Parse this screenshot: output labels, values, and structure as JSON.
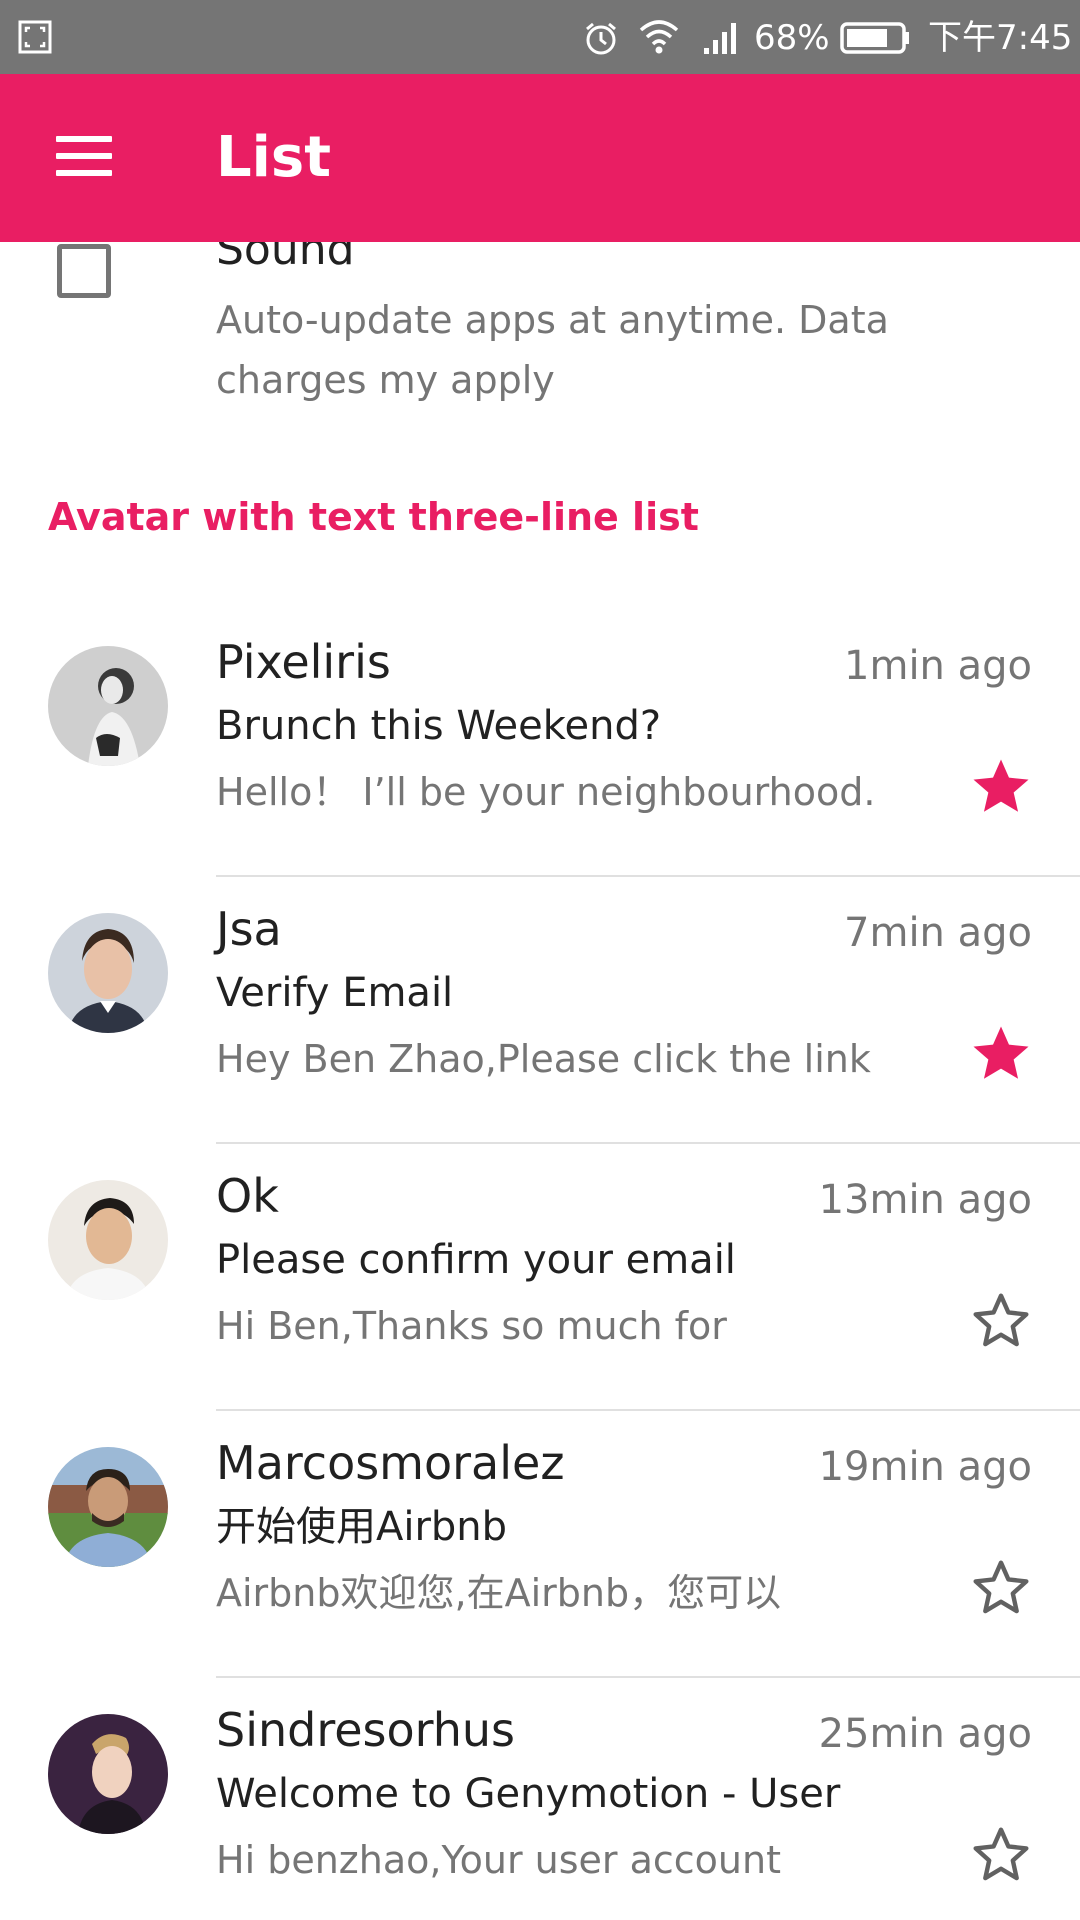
{
  "status_bar": {
    "battery_pct": "68%",
    "clock": "下午7:45",
    "icons": [
      "screenshot-icon",
      "alarm-icon",
      "wifi-icon",
      "signal-icon",
      "battery-icon"
    ]
  },
  "app_bar": {
    "title": "List",
    "menu_icon": "menu-icon"
  },
  "sound_item": {
    "title": "Sound",
    "subtitle": "Auto-update apps at anytime. Data charges my apply",
    "checked": false
  },
  "section": {
    "header": "Avatar with text three-line list"
  },
  "accent_color": "#e91e63",
  "messages": [
    {
      "name": "Pixeliris",
      "time": "1min ago",
      "subject": "Brunch this Weekend?",
      "preview": "Hello！ I’ll be your neighbourhood.",
      "starred": true
    },
    {
      "name": "Jsa",
      "time": "7min ago",
      "subject": "Verify Email",
      "preview": "Hey Ben Zhao,Please click the link",
      "starred": true
    },
    {
      "name": "Ok",
      "time": "13min ago",
      "subject": "Please confirm your email",
      "preview": "Hi Ben,Thanks so much for",
      "starred": false
    },
    {
      "name": "Marcosmoralez",
      "time": "19min ago",
      "subject": "开始使用Airbnb",
      "preview": "Airbnb欢迎您,在Airbnb，您可以",
      "starred": false
    },
    {
      "name": "Sindresorhus",
      "time": "25min ago",
      "subject": "Welcome to Genymotion - User",
      "preview": "Hi benzhao,Your user account",
      "starred": false
    }
  ]
}
